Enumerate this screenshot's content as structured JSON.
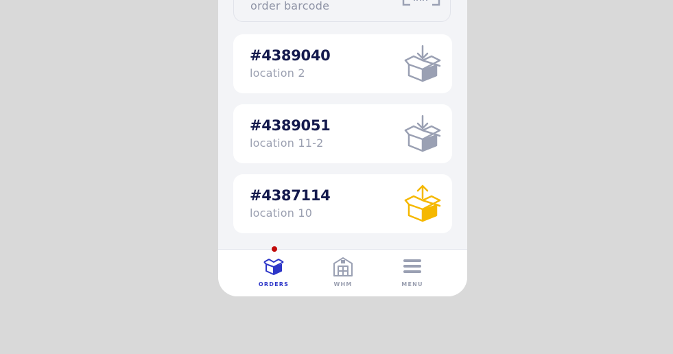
{
  "scan": {
    "placeholder_text": "order barcode",
    "icon": "barcode-scan-icon"
  },
  "orders": [
    {
      "id": "#4389040",
      "location": "location 2",
      "icon": "box-download-icon",
      "icon_color": "#9aa0b3"
    },
    {
      "id": "#4389051",
      "location": "location 11-2",
      "icon": "box-download-icon",
      "icon_color": "#9aa0b3"
    },
    {
      "id": "#4387114",
      "location": "location 10",
      "icon": "box-upload-icon",
      "icon_color": "#f5b800"
    }
  ],
  "tabs": [
    {
      "label": "ORDERS",
      "icon": "box-icon",
      "active": true
    },
    {
      "label": "WHM",
      "icon": "warehouse-icon",
      "active": false
    },
    {
      "label": "MENU",
      "icon": "menu-icon",
      "active": false
    }
  ],
  "colors": {
    "background": "#d9d9d9",
    "card": "#ffffff",
    "title_text": "#141a4d",
    "muted_text": "#9a9fb0",
    "accent_blue": "#2d36c8",
    "accent_yellow": "#f5b800",
    "notification_dot": "#c10a0a"
  }
}
